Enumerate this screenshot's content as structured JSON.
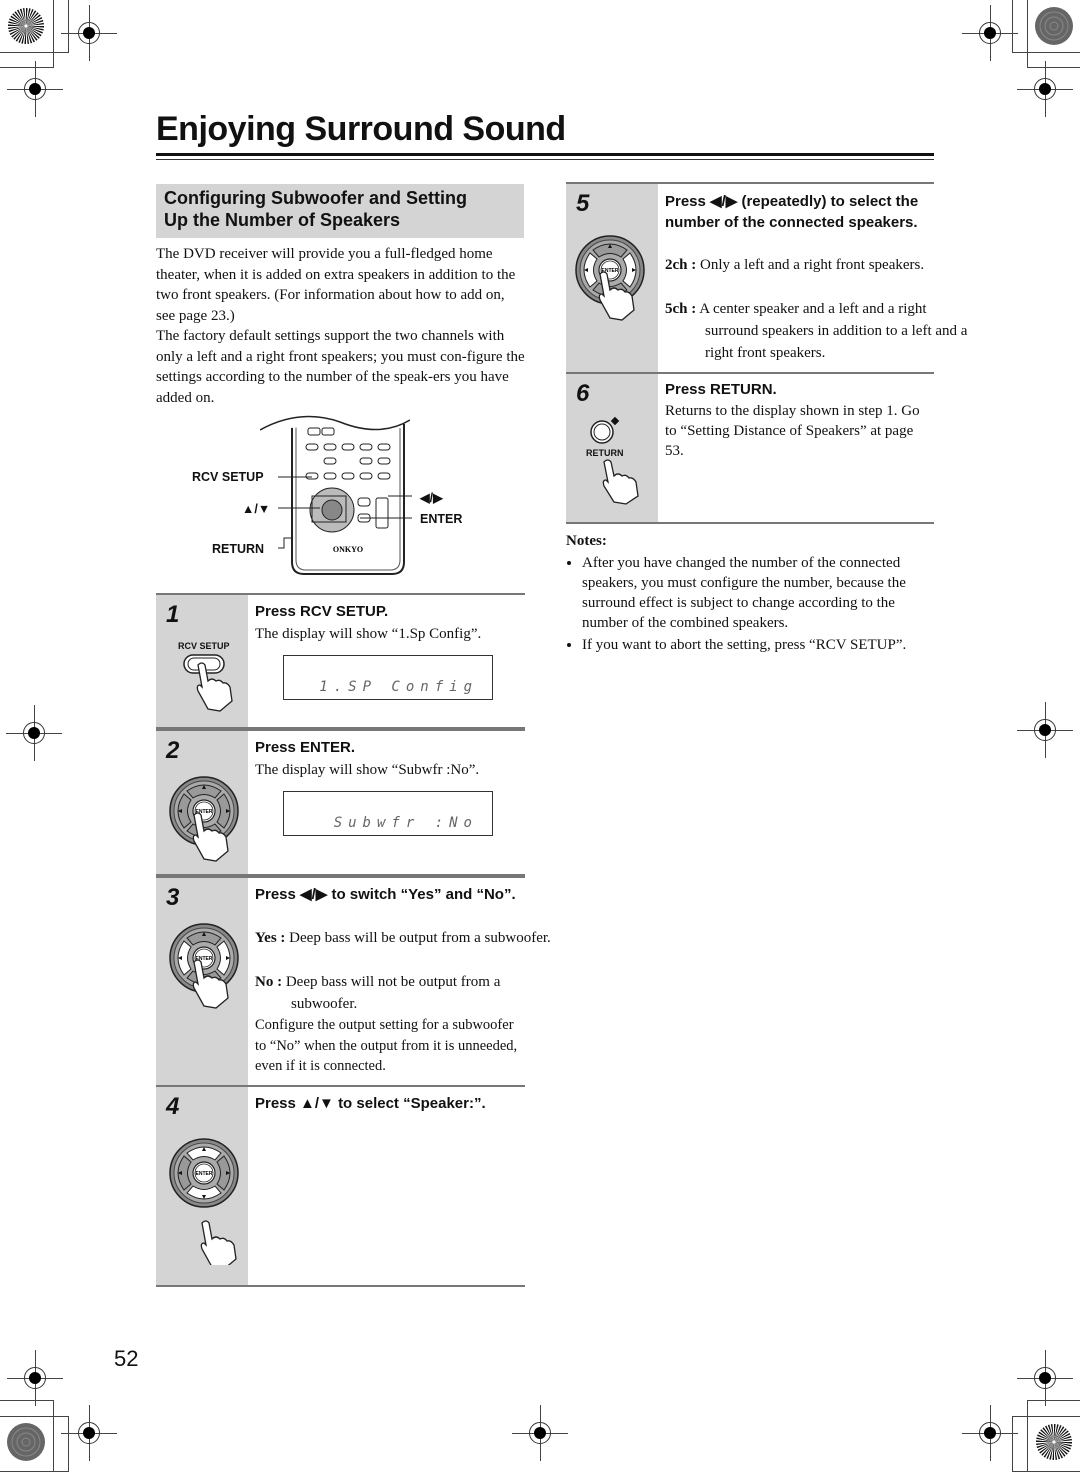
{
  "page": {
    "title": "Enjoying Surround Sound",
    "page_number": "52"
  },
  "section": {
    "heading_line1": "Configuring Subwoofer and Setting",
    "heading_line2": "Up the Number of Speakers",
    "intro_p1": "The DVD receiver will provide you a full-fledged home theater, when it is added on extra speakers in addition to the two front speakers. (For information about how to add on, see page 23.)",
    "intro_p2": "The factory default settings support the two channels with only a left and a right front speakers; you must con-figure the settings according to the number of the speak-ers you have added on."
  },
  "remote": {
    "labels": {
      "rcv_setup": "RCV SETUP",
      "up_down": "▲/▼",
      "return": "RETURN",
      "left_right": "◀/▶",
      "enter": "ENTER"
    },
    "brand": "ONKYO"
  },
  "steps": [
    {
      "number": "1",
      "icon_label": "RCV SETUP",
      "heading": "Press RCV SETUP.",
      "body": "The display will show “1.Sp Config”.",
      "lcd": "1.SP Config"
    },
    {
      "number": "2",
      "icon_label": "ENTER",
      "heading": "Press ENTER.",
      "body": "The display will show “Subwfr :No”.",
      "lcd": "Subwfr :No"
    },
    {
      "number": "3",
      "icon_label": "ENTER",
      "heading": "Press ◀/▶ to switch “Yes” and “No”.",
      "options": [
        {
          "key": "Yes :",
          "text": "Deep bass will be output from a subwoofer."
        },
        {
          "key": "No :",
          "text": "Deep bass will not be output from a subwoofer."
        }
      ],
      "body": "Configure the output setting for a subwoofer to “No” when the output from it is unneeded, even if it is connected."
    },
    {
      "number": "4",
      "icon_label": "ENTER",
      "heading": "Press ▲/▼ to select “Speaker:”."
    },
    {
      "number": "5",
      "icon_label": "ENTER",
      "heading": "Press ◀/▶ (repeatedly) to select the number of the connected speakers.",
      "options": [
        {
          "key": "2ch :",
          "text": "Only a left and a right front speakers."
        },
        {
          "key": "5ch :",
          "text": "A center speaker and a left and a right surround speakers in addition to a left and a right front speakers."
        }
      ]
    },
    {
      "number": "6",
      "icon_label": "RETURN",
      "heading": "Press RETURN.",
      "body": "Returns to the display shown in step 1. Go to “Setting Distance of Speakers” at page 53."
    }
  ],
  "notes": {
    "heading": "Notes:",
    "items": [
      "After you have changed the number of the connected speakers, you must configure the number, because the surround effect is subject to change according to the number of the combined speakers.",
      "If you want to abort the setting, press “RCV SETUP”."
    ]
  }
}
